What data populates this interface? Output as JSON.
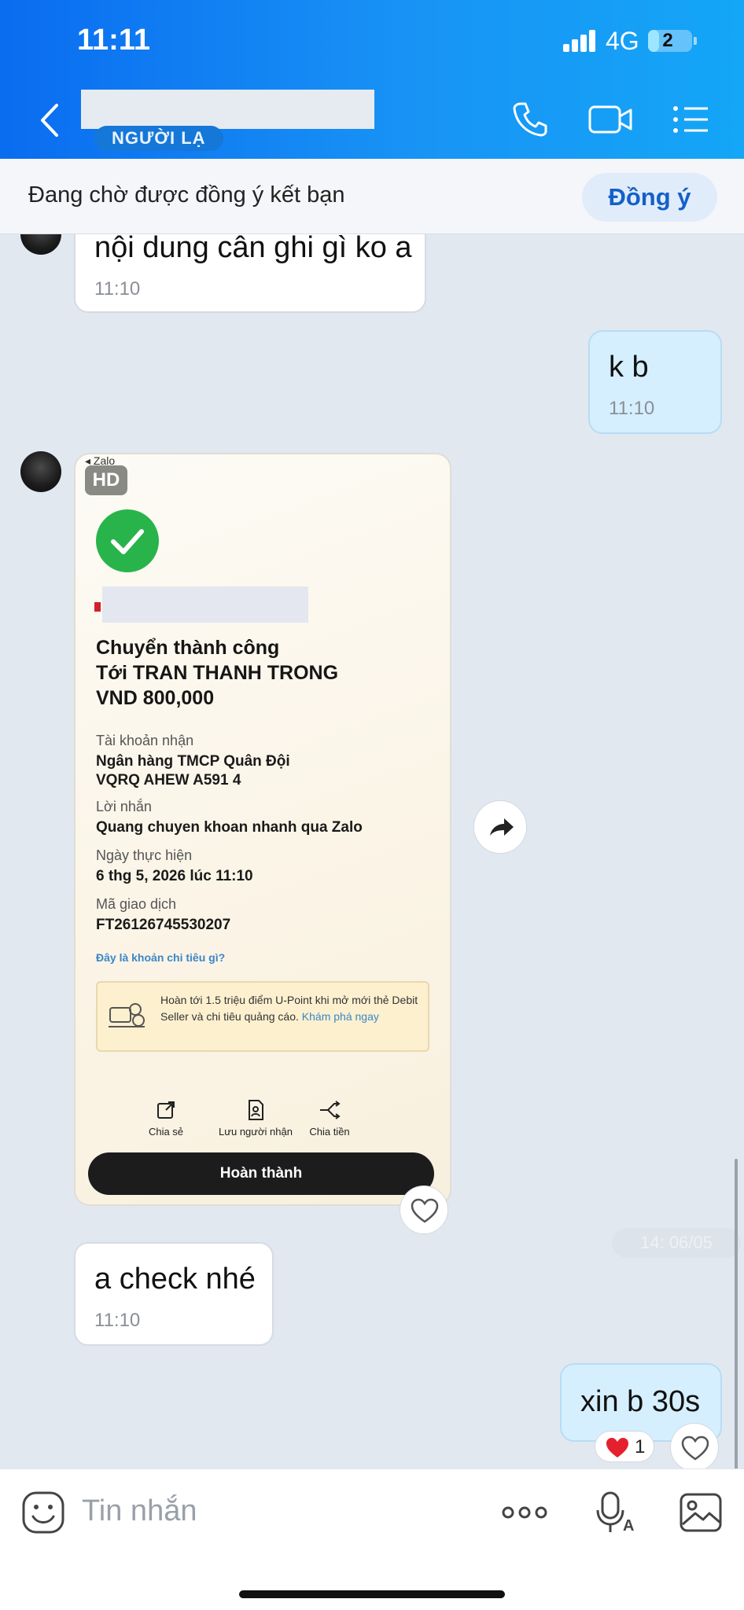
{
  "status_bar": {
    "time": "11:11",
    "network": "4G",
    "battery": "2"
  },
  "header": {
    "stranger_badge": "NGƯỜI LẠ"
  },
  "friend_request": {
    "text": "Đang chờ được đồng ý kết bạn",
    "agree_label": "Đồng ý"
  },
  "messages": [
    {
      "direction": "in",
      "text": "nội dung cân ghi gì ko a",
      "time": "11:10"
    },
    {
      "direction": "out",
      "text": "k b",
      "time": "11:10"
    },
    {
      "direction": "in",
      "text": "a check nhé",
      "time": "11:10"
    },
    {
      "direction": "out",
      "text": "xin b 30s",
      "time": ""
    }
  ],
  "image_message": {
    "hd_label": "HD",
    "source_app": "◂ Zalo",
    "receipt": {
      "status": "Chuyển thành công",
      "recipient_line": "Tới TRAN THANH TRONG",
      "amount": "VND 800,000",
      "account_label": "Tài khoản nhận",
      "account_bank": "Ngân hàng TMCP Quân Đội",
      "account_number": "VQRQ AHEW A591 4",
      "message_label": "Lời nhắn",
      "message_value": "Quang chuyen khoan nhanh qua Zalo",
      "date_label": "Ngày thực hiện",
      "date_value": "6 thg 5, 2026 lúc 11:10",
      "txn_label": "Mã giao dịch",
      "txn_value": "FT26126745530207",
      "spend_link": "Đây là khoản chi tiêu gì?",
      "promo_text": "Hoàn tới 1.5 triệu điểm U-Point khi mở mới thẻ Debit Seller và chi tiêu quảng cáo.",
      "promo_link": "Khám phá ngay",
      "actions": [
        "Chia sẻ",
        "Lưu người nhận",
        "Chia tiền"
      ],
      "done_label": "Hoàn thành"
    }
  },
  "date_separator": "14: 06/05",
  "reaction": {
    "emoji": "heart",
    "count": "1"
  },
  "input": {
    "placeholder": "Tin nhắn"
  },
  "colors": {
    "header_start": "#0a6cf0",
    "header_end": "#14a6f7",
    "out_bubble": "#d5efff",
    "success": "#28b44b"
  }
}
